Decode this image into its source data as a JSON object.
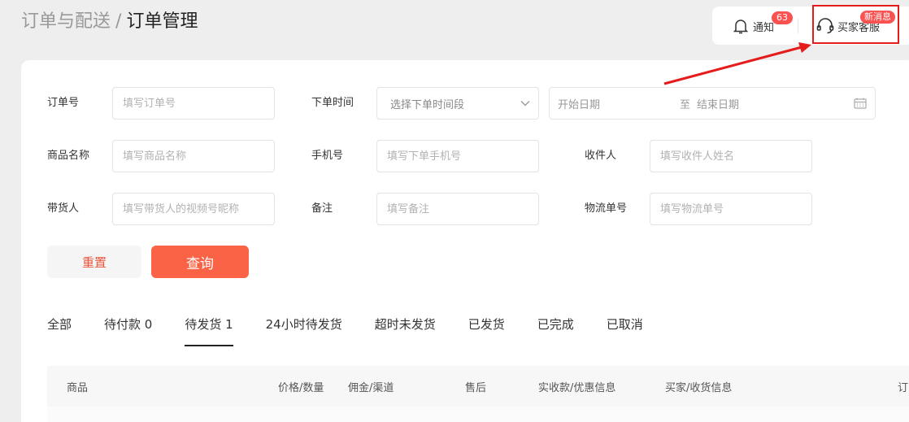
{
  "breadcrumb": {
    "parent": "订单与配送",
    "separator": "/",
    "current": "订单管理"
  },
  "topbar": {
    "notice_label": "通知",
    "notice_count": "63",
    "service_label": "买家客服",
    "service_badge": "新消息"
  },
  "filters": {
    "order_no": {
      "label": "订单号",
      "placeholder": "填写订单号"
    },
    "order_time": {
      "label": "下单时间",
      "select_value": "选择下单时间段",
      "start_placeholder": "开始日期",
      "to": "至",
      "end_placeholder": "结束日期"
    },
    "product_name": {
      "label": "商品名称",
      "placeholder": "填写商品名称"
    },
    "phone": {
      "label": "手机号",
      "placeholder": "填写下单手机号"
    },
    "receiver": {
      "label": "收件人",
      "placeholder": "填写收件人姓名"
    },
    "promoter": {
      "label": "带货人",
      "placeholder": "填写带货人的视频号昵称"
    },
    "remark": {
      "label": "备注",
      "placeholder": "填写备注"
    },
    "tracking_no": {
      "label": "物流单号",
      "placeholder": "填写物流单号"
    }
  },
  "actions": {
    "reset": "重置",
    "query": "查询"
  },
  "tabs": [
    "全部",
    "待付款 0",
    "待发货 1",
    "24小时待发货",
    "超时未发货",
    "已发货",
    "已完成",
    "已取消"
  ],
  "table": {
    "headers": [
      "商品",
      "价格/数量",
      "佣金/渠道",
      "售后",
      "实收款/优惠信息",
      "买家/收货信息",
      "订"
    ]
  },
  "colors": {
    "accent": "#fa6345",
    "badge": "#fa5151",
    "annotation": "#e51c1c"
  }
}
